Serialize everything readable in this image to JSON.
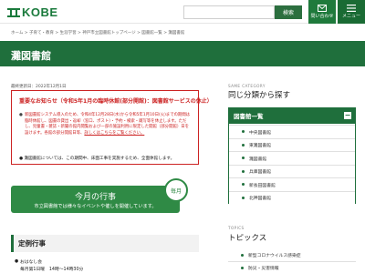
{
  "header": {
    "logo_text": "KOBE",
    "search_button": "検索",
    "contact_label": "問い合わせ",
    "menu_label": "メニュー"
  },
  "breadcrumb": "ホーム > 子育て・教育 > 生涯学習 > 神戸市立図書館トップページ > 図書館一覧 > 灘図書館",
  "page_title": "灘図書館",
  "updated": "最終更新日：2022年12月1日",
  "notice": {
    "title": "重要なお知らせ（令和5年1月の臨時休館(部分開館)：図書館サービスの休止）",
    "body": "新図書館システム導入のため、令和4年12月28日(水)から令和5年1月10日(火)までの期間は臨時休館し、図書の貸出・返却（窓口、ポスト）・予約・検索・蔵写等を休止します。ただし、児童書・雑誌・新聞の館内閲覧および一部の施設利用に限定した開館（部分開館）日を設けます。各館の部分開館日等、詳しくはこちらをご覧ください。",
    "link": "詳しくはこちらをご覧ください。",
    "last": "灘図書館については、この期間中、床面工事を実施するため、全面休館します。"
  },
  "banner": {
    "title": "今月の行事",
    "subtitle": "市立図書館では様々なイベントや催しを開催しています。",
    "badge": "毎月"
  },
  "section": {
    "title": "定例行事",
    "line1": "おはなし会",
    "line2": "毎月第1日曜　14時〜14時30分"
  },
  "sidebar": {
    "eyebrow": "SAME CATEGORY",
    "heading": "同じ分類から探す",
    "box_title": "図書館一覧",
    "toggle": "−",
    "items": [
      "中央図書館",
      "東灘図書館",
      "灘図書館",
      "兵庫図書館",
      "新長田図書館",
      "北神図書館"
    ]
  },
  "topics": {
    "eyebrow": "TOPICS",
    "heading": "トピックス",
    "items": [
      "新型コロナウイルス感染症",
      "防災・災害情報"
    ]
  },
  "colors": {
    "brand_green": "#1f6f3c",
    "notice_red": "#cc2222"
  }
}
